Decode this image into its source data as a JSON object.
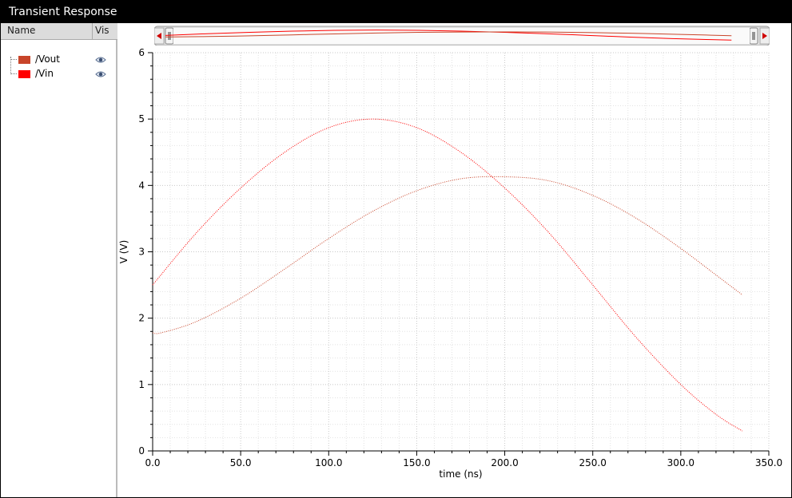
{
  "window": {
    "title": "Transient Response"
  },
  "sidebar": {
    "col_name": "Name",
    "col_vis": "Vis",
    "signals": [
      {
        "name": "/Vout",
        "color": "#c8452a"
      },
      {
        "name": "/Vin",
        "color": "#ff0000"
      }
    ]
  },
  "chart_data": {
    "type": "line",
    "xlabel": "time (ns)",
    "ylabel": "V (V)",
    "xlim": [
      0,
      350
    ],
    "ylim": [
      0,
      6
    ],
    "x_ticks": [
      "0.0",
      "50.0",
      "100.0",
      "150.0",
      "200.0",
      "250.0",
      "300.0",
      "350.0"
    ],
    "y_ticks": [
      "0",
      "1",
      "2",
      "3",
      "4",
      "5",
      "6"
    ],
    "grid": true,
    "line_style": "dotted",
    "series": [
      {
        "name": "/Vin",
        "color": "#ff0000",
        "x": [
          0,
          25,
          50,
          75,
          100,
          125,
          150,
          175,
          200,
          225,
          250,
          275,
          300,
          320,
          335
        ],
        "y": [
          2.5,
          3.29,
          3.96,
          4.5,
          4.87,
          5.0,
          4.87,
          4.5,
          3.96,
          3.29,
          2.5,
          1.7,
          1.0,
          0.55,
          0.3
        ]
      },
      {
        "name": "/Vout",
        "color": "#c8452a",
        "x": [
          0,
          5,
          25,
          50,
          75,
          100,
          125,
          150,
          175,
          200,
          225,
          250,
          275,
          300,
          320,
          335
        ],
        "y": [
          1.78,
          1.78,
          1.95,
          2.3,
          2.74,
          3.2,
          3.61,
          3.92,
          4.1,
          4.13,
          4.07,
          3.85,
          3.5,
          3.05,
          2.65,
          2.35
        ]
      }
    ]
  }
}
